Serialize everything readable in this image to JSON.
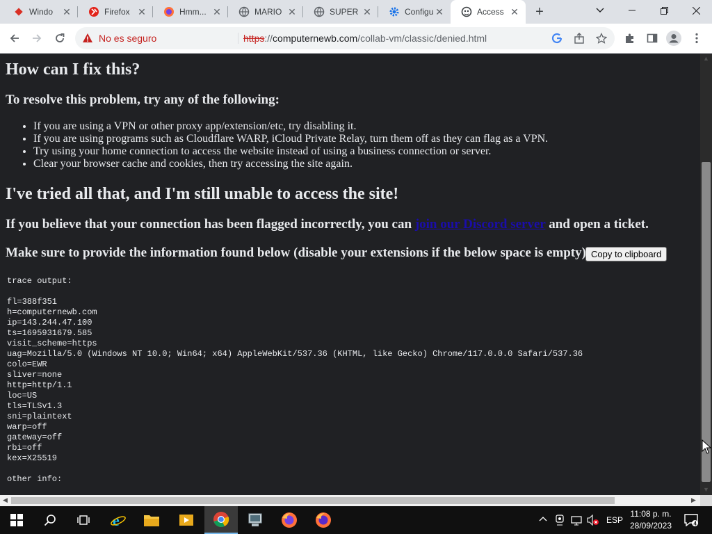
{
  "browser": {
    "tabs": [
      {
        "title": "Windo",
        "icon": "red-diamond-icon"
      },
      {
        "title": "Firefox",
        "icon": "red-logo-icon"
      },
      {
        "title": "Hmm...",
        "icon": "firefox-icon"
      },
      {
        "title": "MARIO",
        "icon": "globe-icon"
      },
      {
        "title": "SUPER",
        "icon": "globe-icon"
      },
      {
        "title": "Configu",
        "icon": "gear-icon"
      },
      {
        "title": "Access",
        "icon": "gorilla-icon"
      }
    ],
    "address": {
      "security_label": "No es seguro",
      "scheme": "https",
      "rest": "://",
      "host": "computernewb.com",
      "path": "/collab-vm/classic/denied.html"
    }
  },
  "page": {
    "fix_heading": "How can I fix this?",
    "resolve_heading": "To resolve this problem, try any of the following:",
    "tips": [
      "If you are using a VPN or other proxy app/extension/etc, try disabling it.",
      "If you are using programs such as Cloudflare WARP, iCloud Private Relay, turn them off as they can flag as a VPN.",
      "Try using your home connection to access the website instead of using a business connection or server.",
      "Clear your browser cache and cookies, then try accessing the site again."
    ],
    "still_heading": "I've tried all that, and I'm still unable to access the site!",
    "flagged_pre": "If you believe that your connection has been flagged incorrectly, you can ",
    "flagged_link": "join our Discord server",
    "flagged_post": " and open a ticket.",
    "provide_heading": "Make sure to provide the information found below (disable your extensions if the below space is empty):",
    "copy_button": "Copy to clipboard",
    "trace": "trace output:\n\nfl=388f351\nh=computernewb.com\nip=143.244.47.100\nts=1695931679.585\nvisit_scheme=https\nuag=Mozilla/5.0 (Windows NT 10.0; Win64; x64) AppleWebKit/537.36 (KHTML, like Gecko) Chrome/117.0.0.0 Safari/537.36\ncolo=EWR\nsliver=none\nhttp=http/1.1\nloc=US\ntls=TLSv1.3\nsni=plaintext\nwarp=off\ngateway=off\nrbi=off\nkex=X25519\n\nother info:"
  },
  "taskbar": {
    "language": "ESP",
    "time": "11:08 p. m.",
    "date": "28/09/2023",
    "notifications": "4"
  }
}
